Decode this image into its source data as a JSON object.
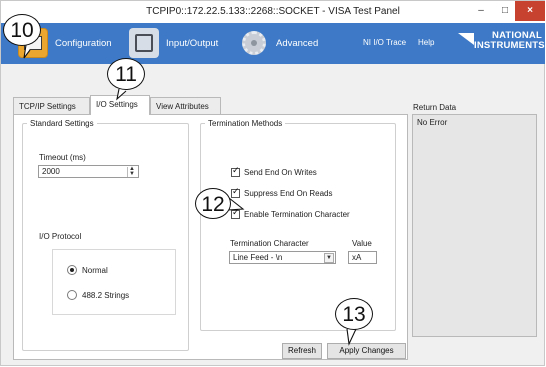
{
  "window": {
    "title": "TCPIP0::172.22.5.133::2268::SOCKET - VISA Test Panel",
    "minimize_glyph": "–",
    "maximize_glyph": "□",
    "close_glyph": "×"
  },
  "toolbar": {
    "configuration": "Configuration",
    "input_output": "Input/Output",
    "advanced": "Advanced",
    "ni_io_trace": "NI I/O Trace",
    "help": "Help",
    "logo_line1": "NATIONAL",
    "logo_line2": "INSTRUMENTS",
    "accent_color": "#3d79c6",
    "config_icon_color": "#eba62f"
  },
  "tabs": [
    "TCP/IP Settings",
    "I/O Settings",
    "View Attributes"
  ],
  "standard_settings": {
    "legend": "Standard Settings",
    "timeout_label": "Timeout (ms)",
    "timeout_value": "2000",
    "protocol_label": "I/O Protocol",
    "options": [
      "Normal",
      "488.2 Strings"
    ],
    "selected": "Normal"
  },
  "termination": {
    "legend": "Termination Methods",
    "checks": [
      {
        "label": "Send End On Writes",
        "checked": true
      },
      {
        "label": "Suppress End On Reads",
        "checked": true
      },
      {
        "label": "Enable Termination Character",
        "checked": true
      }
    ],
    "char_label": "Termination Character",
    "char_value": "Line Feed - \\n",
    "value_label": "Value",
    "value_value": "xA"
  },
  "buttons": {
    "refresh": "Refresh",
    "apply": "Apply Changes"
  },
  "return_data": {
    "label": "Return Data",
    "text": "No Error"
  },
  "callouts": [
    "10",
    "11",
    "12",
    "13"
  ]
}
